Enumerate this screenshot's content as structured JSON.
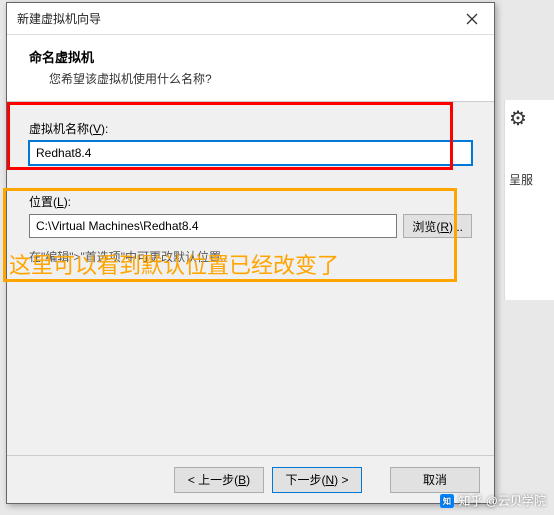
{
  "bg": {
    "snip1": "呈服"
  },
  "titlebar": {
    "text": "新建虚拟机向导"
  },
  "header": {
    "title": "命名虚拟机",
    "subtitle": "您希望该虚拟机使用什么名称?"
  },
  "vmname": {
    "label_pre": "虚拟机名称(",
    "label_key": "V",
    "label_post": "):",
    "value": "Redhat8.4"
  },
  "location": {
    "label_pre": "位置(",
    "label_key": "L",
    "label_post": "):",
    "value": "C:\\Virtual Machines\\Redhat8.4",
    "browse_pre": "浏览(",
    "browse_key": "R",
    "browse_post": ")..."
  },
  "hint": "在\"编辑\">\"首选项\"中可更改默认位置。",
  "annotation": "这里可以看到默认位置已经改变了",
  "footer": {
    "back_pre": "< 上一步(",
    "back_key": "B",
    "back_post": ")",
    "next_pre": "下一步(",
    "next_key": "N",
    "next_post": ") >",
    "cancel": "取消"
  },
  "watermark": "知乎 @云贝学院"
}
